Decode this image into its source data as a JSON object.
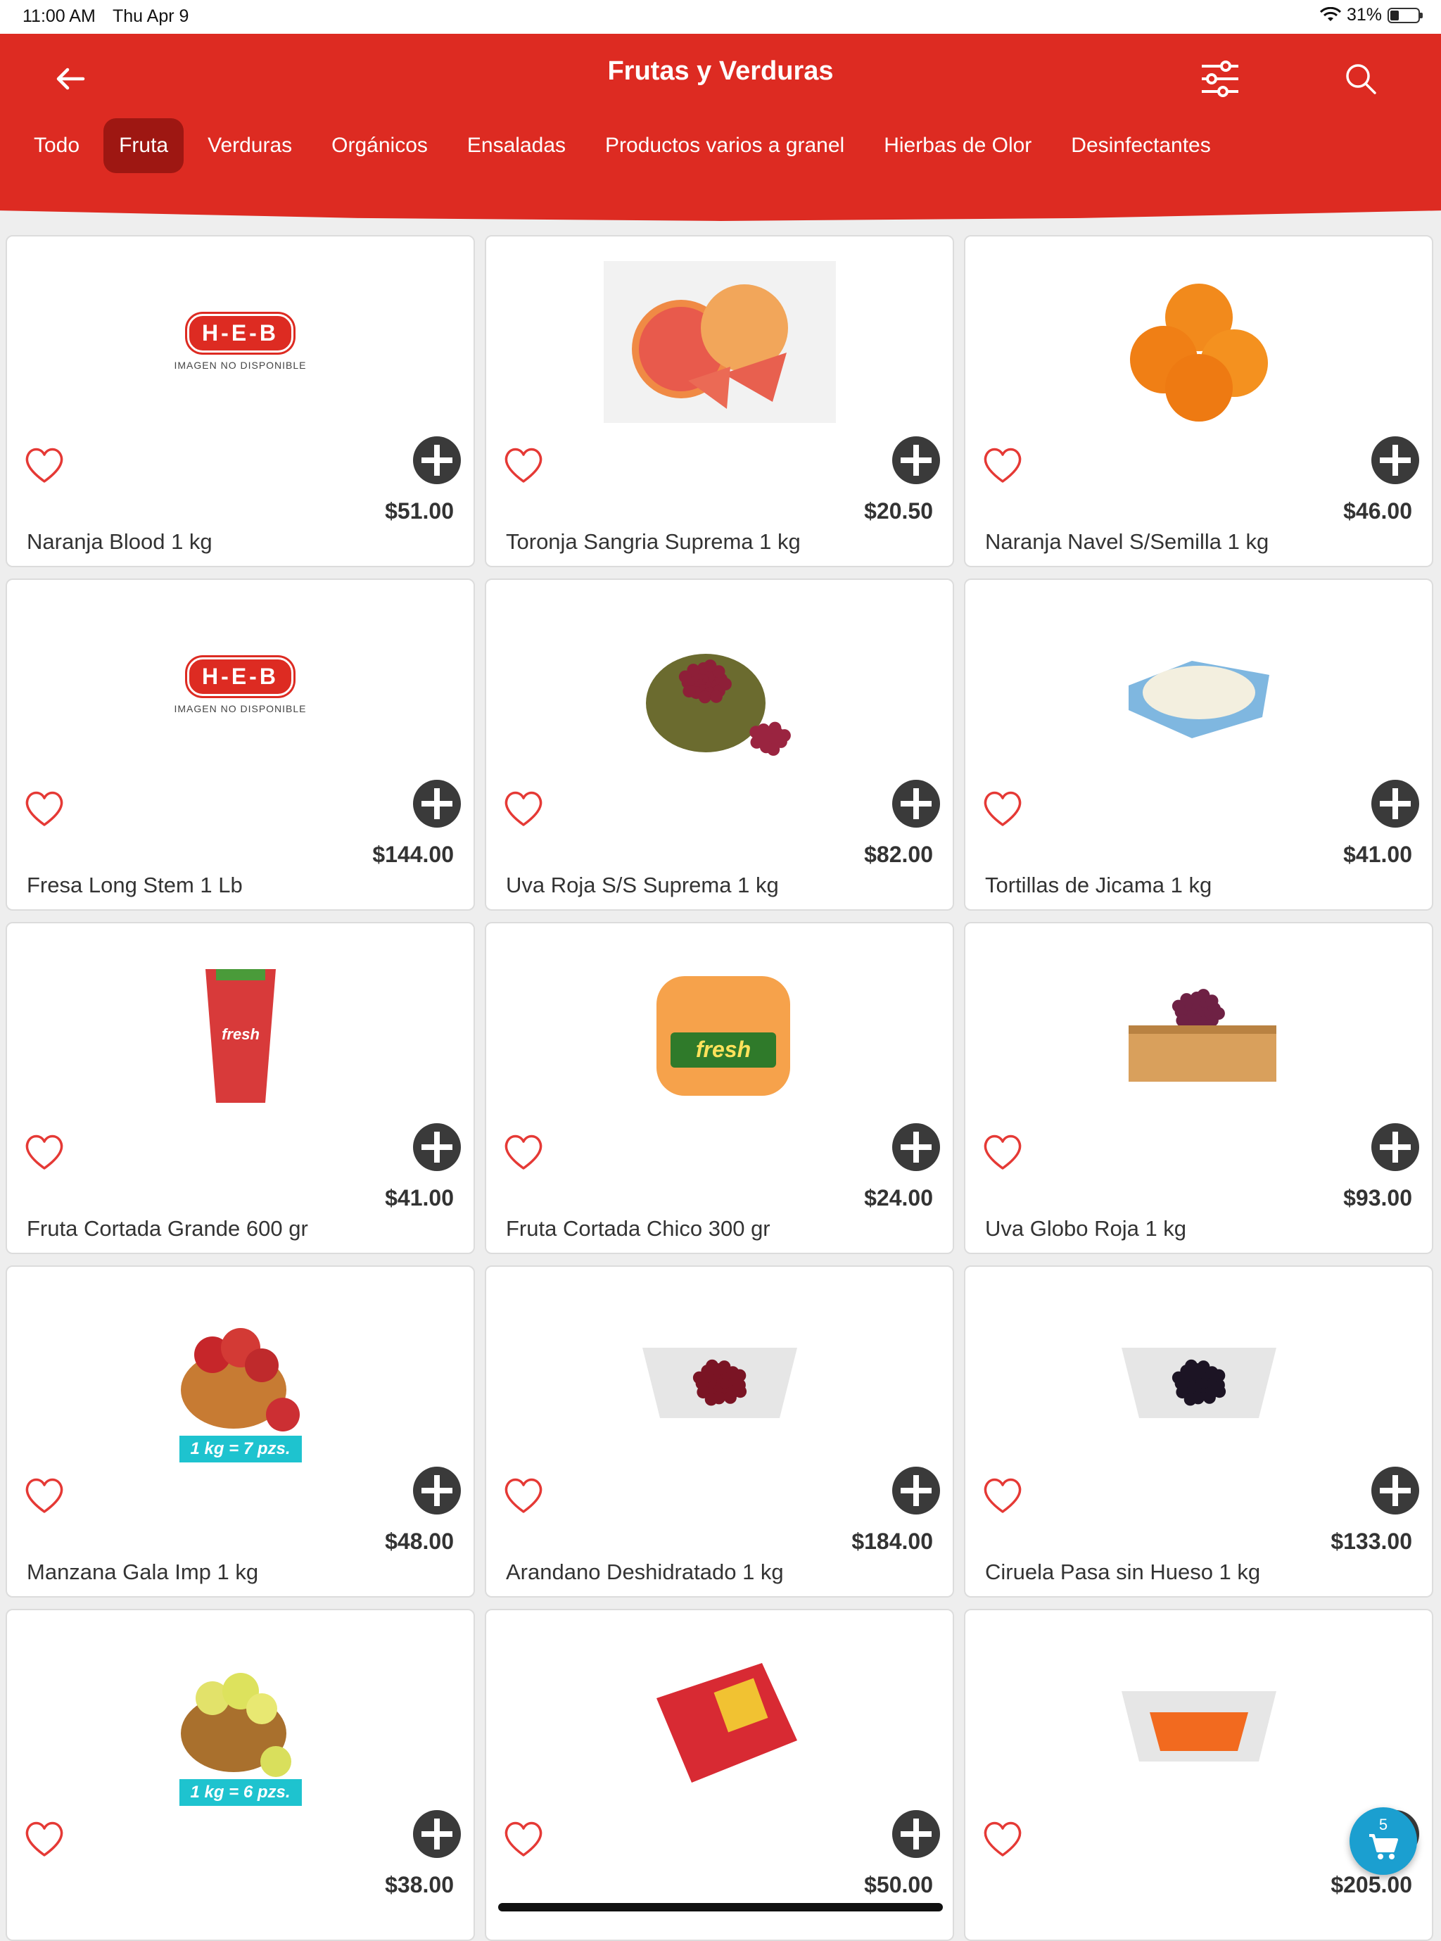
{
  "status_bar": {
    "time": "11:00 AM",
    "date": "Thu Apr 9",
    "battery": "31%",
    "battery_level": 0.31
  },
  "header": {
    "title": "Frutas y Verduras",
    "tabs": [
      "Todo",
      "Fruta",
      "Verduras",
      "Orgánicos",
      "Ensaladas",
      "Productos varios a granel",
      "Hierbas de Olor",
      "Desinfectantes"
    ],
    "active_tab": "Fruta"
  },
  "theme": {
    "brand_red": "#dd2b22",
    "active_tab_bg": "#9e1712",
    "accent_teal": "#1ec3cf",
    "cart_blue": "#1b9fd0"
  },
  "image_placeholder": {
    "logo": "H-E-B",
    "caption": "IMAGEN NO DISPONIBLE"
  },
  "products": [
    {
      "name": "Naranja Blood 1 kg",
      "price": "$51.00",
      "image": "heb-placeholder"
    },
    {
      "name": "Toronja Sangria Suprema 1 kg",
      "price": "$20.50",
      "image": "grapefruit"
    },
    {
      "name": "Naranja Navel S/Semilla 1 kg",
      "price": "$46.00",
      "image": "oranges"
    },
    {
      "name": "Fresa Long Stem 1 Lb",
      "price": "$144.00",
      "image": "heb-placeholder"
    },
    {
      "name": "Uva Roja S/S Suprema 1 kg",
      "price": "$82.00",
      "image": "red-grapes-bowl"
    },
    {
      "name": "Tortillas de Jicama 1 kg",
      "price": "$41.00",
      "image": "jicama-tortillas"
    },
    {
      "name": "Fruta Cortada Grande 600 gr",
      "price": "$41.00",
      "image": "fresh-cup"
    },
    {
      "name": "Fruta Cortada Chico 300 gr",
      "price": "$24.00",
      "image": "fresh-tub"
    },
    {
      "name": "Uva Globo Roja 1 kg",
      "price": "$93.00",
      "image": "grapes-crate"
    },
    {
      "name": "Manzana Gala Imp 1 kg",
      "price": "$48.00",
      "image": "apple-bowl",
      "tag": "1 kg = 7 pzs."
    },
    {
      "name": "Arandano Deshidratado 1 kg",
      "price": "$184.00",
      "image": "cranberry-tray"
    },
    {
      "name": "Ciruela Pasa sin Hueso 1 kg",
      "price": "$133.00",
      "image": "prune-tray"
    },
    {
      "name": "",
      "price": "$38.00",
      "image": "yellow-apple-bowl",
      "tag": "1 kg = 6 pzs."
    },
    {
      "name": "",
      "price": "$50.00",
      "image": "strawberry-pack"
    },
    {
      "name": "",
      "price": "$205.00",
      "image": "papaya-tray"
    }
  ],
  "cart": {
    "count": "5"
  }
}
